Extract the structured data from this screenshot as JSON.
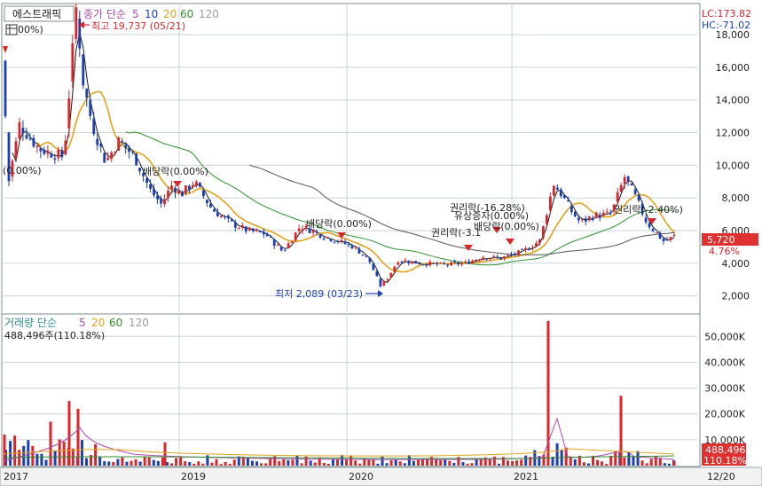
{
  "header": {
    "stock_name": "에스트래픽",
    "price_legend": {
      "base": "종가 단순",
      "periods": [
        "5",
        "10",
        "20",
        "60",
        "120"
      ]
    },
    "lc": "LC:173.82",
    "hc": "HC:-71.02",
    "percent_label": "00%)"
  },
  "volume_header": {
    "base": "거래량 단순",
    "periods": [
      "5",
      "20",
      "60",
      "120"
    ],
    "current": "488,496주(110.18%)"
  },
  "annotations": {
    "high": "최고 19,737 (05/21)",
    "low": "최저 2,089 (03/23)",
    "div1": "배당락(0.00%)",
    "div2": "배당락(0.00%)",
    "left_partial": "(0.00%)",
    "rights1": "권리락(-16.28%)",
    "rights2": "권리락(-3.1",
    "bonus": "유상증자(0.00%)",
    "div3": "배당락(0.00%)",
    "rights3": "권리락(-2.40%)"
  },
  "last_price": {
    "value": "5,720",
    "change": "4.76%"
  },
  "last_volume": {
    "value": "488,496",
    "ratio": "110.18%"
  },
  "x_labels": [
    "2017",
    "2019",
    "2020",
    "2021",
    "12/20"
  ],
  "colors": {
    "up": "#d8262a",
    "down": "#1b3fb0",
    "ma5": "#1a1a1a",
    "ma20": "#e0a41c",
    "ma60": "#2f8f2f",
    "ma120": "#555555",
    "grid": "#c8d6d6",
    "label_bg": "#e03131"
  },
  "chart_data": [
    {
      "type": "candlestick",
      "title": "",
      "y_ticks": [
        2000,
        4000,
        6000,
        8000,
        10000,
        12000,
        14000,
        16000,
        18000
      ],
      "ylim": [
        1000,
        19800
      ],
      "x_range": [
        "2017",
        "12/20"
      ],
      "grid": true,
      "moving_averages": [
        "5",
        "20",
        "60",
        "120"
      ],
      "close_series": [
        {
          "x": "2017",
          "y": 17500
        },
        {
          "x": "2017",
          "y": 8500
        },
        {
          "x": "2018-04",
          "y": 12500
        },
        {
          "x": "2018-05",
          "y": 19737
        },
        {
          "x": "2018-06",
          "y": 14500
        },
        {
          "x": "2018-08",
          "y": 11000
        },
        {
          "x": "2018-10",
          "y": 10000
        },
        {
          "x": "2018-12",
          "y": 7200
        },
        {
          "x": "2019-02",
          "y": 8800
        },
        {
          "x": "2019-04",
          "y": 7200
        },
        {
          "x": "2019-07",
          "y": 6000
        },
        {
          "x": "2019-10",
          "y": 5500
        },
        {
          "x": "2020-01",
          "y": 4700
        },
        {
          "x": "2020-03",
          "y": 2089
        },
        {
          "x": "2020-05",
          "y": 4200
        },
        {
          "x": "2020-08",
          "y": 3900
        },
        {
          "x": "2020-11",
          "y": 4500
        },
        {
          "x": "2021-01",
          "y": 5000
        },
        {
          "x": "2021-03",
          "y": 8800
        },
        {
          "x": "2021-05",
          "y": 6500
        },
        {
          "x": "2021-08",
          "y": 7200
        },
        {
          "x": "2021-09",
          "y": 9600
        },
        {
          "x": "2021-11",
          "y": 6000
        },
        {
          "x": "12/20",
          "y": 5720
        }
      ]
    },
    {
      "type": "bar",
      "title": "",
      "y_ticks": [
        10000,
        20000,
        30000,
        40000,
        50000
      ],
      "y_tick_labels": [
        "10,000K",
        "20,000K",
        "30,000K",
        "40,000K",
        "50,000K"
      ],
      "unit": "K shares",
      "ylim": [
        0,
        58000
      ],
      "spikes": [
        {
          "x": "2017",
          "y": 12000
        },
        {
          "x": "2018-03",
          "y": 17000
        },
        {
          "x": "2018-05",
          "y": 25000
        },
        {
          "x": "2018-06",
          "y": 22000
        },
        {
          "x": "2018-09",
          "y": 10000
        },
        {
          "x": "2019-01",
          "y": 4000
        },
        {
          "x": "2021-03",
          "y": 56000
        },
        {
          "x": "2021-04",
          "y": 17000
        },
        {
          "x": "2021-09",
          "y": 27000
        },
        {
          "x": "12/20",
          "y": 488
        }
      ]
    }
  ]
}
